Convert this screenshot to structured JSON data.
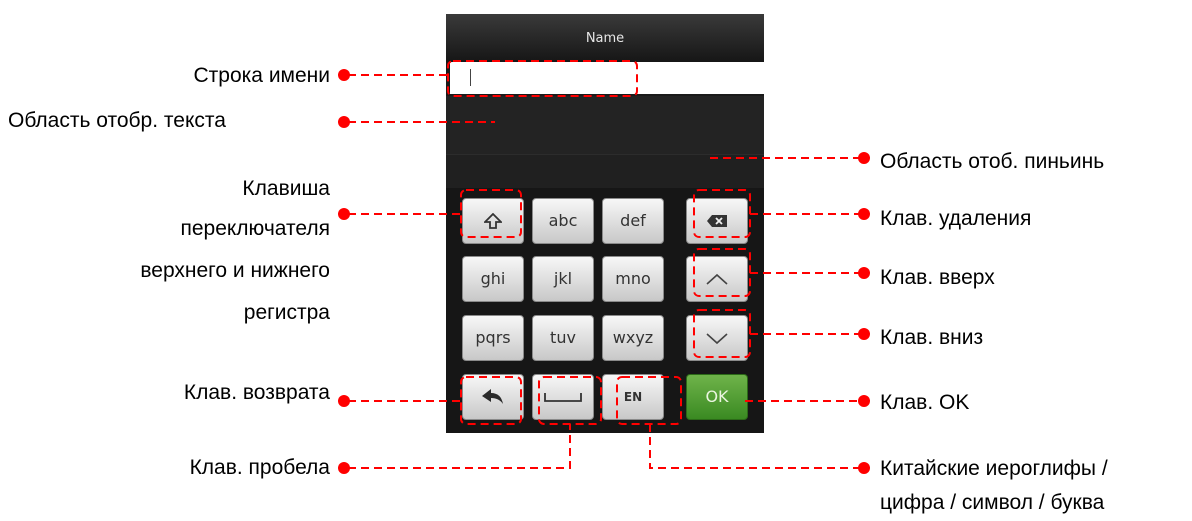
{
  "screen": {
    "title": "Name",
    "keys": {
      "shift_icon": "shift-icon",
      "abc": "abc",
      "def": "def",
      "delete_icon": "backspace-icon",
      "ghi": "ghi",
      "jkl": "jkl",
      "mno": "mno",
      "up_icon": "chevron-up-icon",
      "pqrs": "pqrs",
      "tuv": "tuv",
      "wxyz": "wxyz",
      "down_icon": "chevron-down-icon",
      "back_icon": "back-arrow-icon",
      "space_icon": "space-bar-icon",
      "en": "EN",
      "ok": "OK"
    }
  },
  "labels": {
    "name_line": "Строка имени",
    "text_area": "Область отобр. текста",
    "case_key_1": "Клавиша",
    "case_key_2": "переключателя",
    "case_key_3": "верхнего и нижнего",
    "case_key_4": "регистра",
    "return_key": "Клав. возврата",
    "space_key": "Клав. пробела",
    "pinyin_area": "Область отоб. пиньинь",
    "delete_key": "Клав. удаления",
    "up_key": "Клав. вверх",
    "down_key": "Клав. вниз",
    "ok_key": "Клав. OK",
    "chars_1": "Китайские иероглифы /",
    "chars_2": "цифра / символ / буква"
  },
  "colors": {
    "annotation": "#ff0000",
    "ok_key": "#4a9a2e"
  }
}
